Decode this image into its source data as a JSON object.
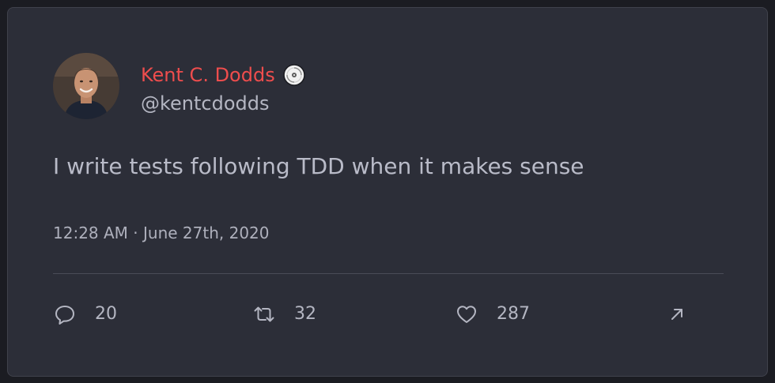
{
  "tweet": {
    "author_name": "Kent C. Dodds",
    "author_handle": "@kentcdodds",
    "badge_icon": "disc-icon",
    "text": "I write tests following TDD when it makes sense",
    "timestamp": "12:28 AM · June 27th, 2020"
  },
  "actions": {
    "reply": {
      "icon": "reply-icon",
      "count": "20"
    },
    "retweet": {
      "icon": "retweet-icon",
      "count": "32"
    },
    "like": {
      "icon": "heart-icon",
      "count": "287"
    },
    "share": {
      "icon": "external-link-arrow-icon"
    }
  },
  "colors": {
    "page_background": "#1b1c22",
    "card_background": "#2c2e38",
    "author_name": "#ee4d4d",
    "text": "#b9bbc8",
    "muted_text": "#aeb0bc",
    "divider": "#4a4c58"
  }
}
